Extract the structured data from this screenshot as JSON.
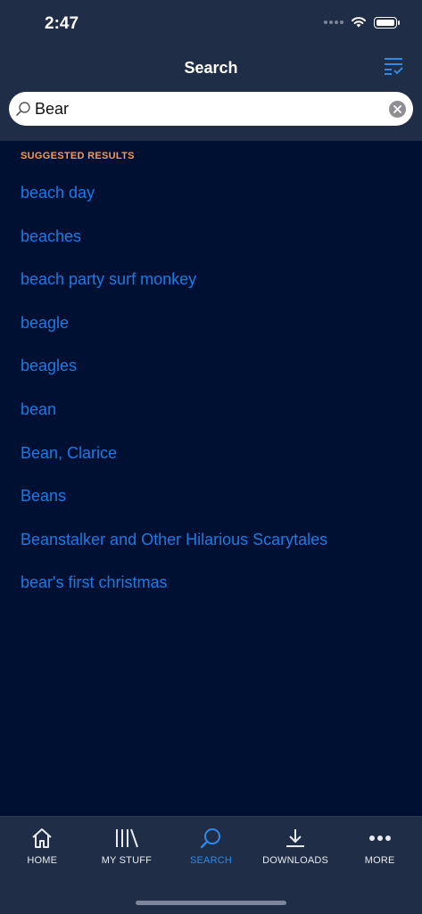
{
  "status_bar": {
    "time": "2:47"
  },
  "header": {
    "title": "Search"
  },
  "search": {
    "value": "Bear"
  },
  "suggestions": {
    "label": "SUGGESTED RESULTS",
    "items": [
      "beach day",
      "beaches",
      "beach party surf monkey",
      "beagle",
      "beagles",
      "bean",
      "Bean, Clarice",
      "Beans",
      "Beanstalker and Other Hilarious Scarytales",
      "bear's first christmas"
    ]
  },
  "tabbar": {
    "tabs": [
      {
        "label": "HOME",
        "icon": "home-icon"
      },
      {
        "label": "MY STUFF",
        "icon": "library-icon"
      },
      {
        "label": "SEARCH",
        "icon": "search-icon",
        "active": true
      },
      {
        "label": "DOWNLOADS",
        "icon": "download-icon"
      },
      {
        "label": "MORE",
        "icon": "more-icon"
      }
    ]
  },
  "colors": {
    "background": "#001033",
    "header": "#1f2d46",
    "link": "#1d79e3",
    "section_label": "#f39a5a",
    "active_tab": "#2d8ae8"
  }
}
